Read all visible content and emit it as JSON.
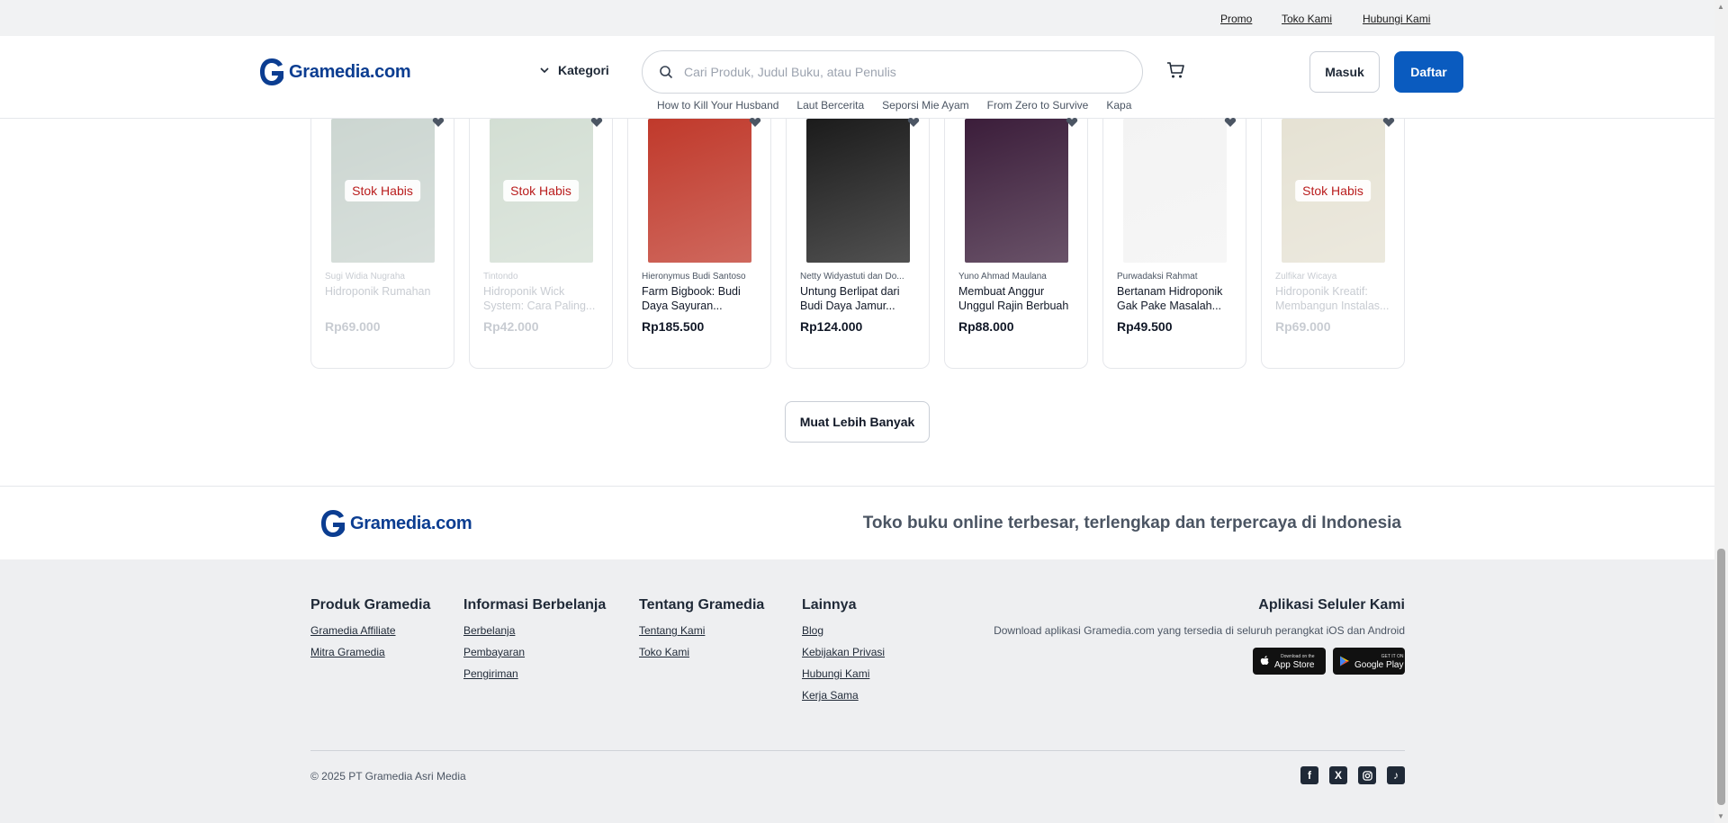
{
  "topbar": {
    "promo": "Promo",
    "toko_kami": "Toko Kami",
    "hubungi_kami": "Hubungi Kami"
  },
  "header": {
    "logo_text": "Gramedia.com",
    "kategori_label": "Kategori",
    "search_placeholder": "Cari Produk, Judul Buku, atau Penulis",
    "login_label": "Masuk",
    "register_label": "Daftar",
    "trending": [
      "How to Kill Your Husband",
      "Laut Bercerita",
      "Seporsi Mie Ayam",
      "From Zero to Survive",
      "Kapa"
    ]
  },
  "products": [
    {
      "author": "Sugi Widia Nugraha",
      "title": "Hidroponik Rumahan",
      "price": "Rp69.000",
      "stock_label": "Stok Habis",
      "cover_color": "#8fa59a"
    },
    {
      "author": "Tintondo",
      "title": "Hidroponik Wick System: Cara Paling...",
      "price": "Rp42.000",
      "stock_label": "Stok Habis",
      "cover_color": "#9fb8a0"
    },
    {
      "author": "Hieronymus Budi Santoso",
      "title": "Farm Bigbook: Budi Daya Sayuran...",
      "price": "Rp185.500",
      "stock_label": "",
      "cover_color": "#c0392b"
    },
    {
      "author": "Netty Widyastuti dan Do...",
      "title": "Untung Berlipat dari Budi Daya Jamur...",
      "price": "Rp124.000",
      "stock_label": "",
      "cover_color": "#1b1b1b"
    },
    {
      "author": "Yuno Ahmad Maulana",
      "title": "Membuat Anggur Unggul Rajin Berbuah",
      "price": "Rp88.000",
      "stock_label": "",
      "cover_color": "#3b1d3a"
    },
    {
      "author": "Purwadaksi Rahmat",
      "title": "Bertanam Hidroponik Gak Pake Masalah...",
      "price": "Rp49.500",
      "stock_label": "",
      "cover_color": "#f3f3f3"
    },
    {
      "author": "Zulfikar Wicaya",
      "title": "Hidroponik Kreatif: Membangun Instalas...",
      "price": "Rp69.000",
      "stock_label": "Stok Habis",
      "cover_color": "#c8c0a0"
    }
  ],
  "load_more_label": "Muat Lebih Banyak",
  "brand_strip": {
    "logo_text": "Gramedia.com",
    "tagline": "Toko buku online terbesar, terlengkap dan terpercaya di Indonesia"
  },
  "footer": {
    "columns": [
      {
        "heading": "Produk Gramedia",
        "links": [
          "Gramedia Affiliate",
          "Mitra Gramedia"
        ]
      },
      {
        "heading": "Informasi Berbelanja",
        "links": [
          "Berbelanja",
          "Pembayaran",
          "Pengiriman"
        ]
      },
      {
        "heading": "Tentang Gramedia",
        "links": [
          "Tentang Kami",
          "Toko Kami"
        ]
      },
      {
        "heading": "Lainnya",
        "links": [
          "Blog",
          "Kebijakan Privasi",
          "Hubungi Kami",
          "Kerja Sama"
        ]
      }
    ],
    "apps_heading": "Aplikasi Seluler Kami",
    "apps_desc": "Download aplikasi Gramedia.com yang tersedia di seluruh perangkat iOS dan Android",
    "app_store": {
      "small": "Download on the",
      "big": "App Store"
    },
    "google_play": {
      "small": "GET IT ON",
      "big": "Google Play"
    },
    "copyright": "© 2025 PT Gramedia Asri Media",
    "social": [
      "facebook-icon",
      "x-icon",
      "instagram-icon",
      "tiktok-icon"
    ]
  },
  "colors": {
    "brand_blue": "#0a5bbf",
    "logo_blue": "#0b3d91",
    "out_of_stock": "#b91c1c"
  }
}
